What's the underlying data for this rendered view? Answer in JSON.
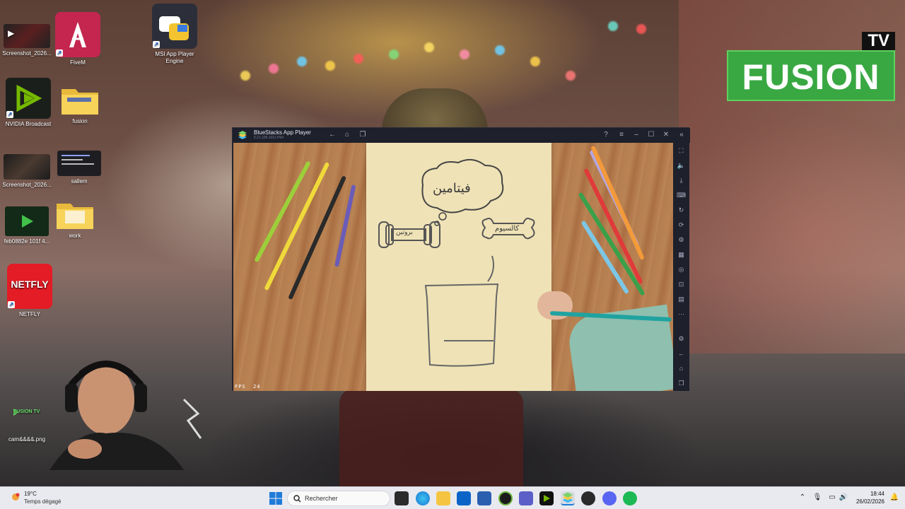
{
  "desktop": {
    "icons": [
      {
        "label": "Screenshot_2026..."
      },
      {
        "label": "FiveM"
      },
      {
        "label": "MSI App Player Engine"
      },
      {
        "label": "NVIDIA Broadcast"
      },
      {
        "label": "fusion"
      },
      {
        "label": "Screenshot_2026..."
      },
      {
        "label": "sallem"
      },
      {
        "label": "feb0882e 101f 4..."
      },
      {
        "label": "work"
      },
      {
        "label": "NETFLY",
        "thumb_text": "NETFLY"
      },
      {
        "label": "cam&&&&.png",
        "thumb_text": "FUSION TV"
      }
    ]
  },
  "overlay": {
    "logo_tv": "TV",
    "logo_word": "FUSION"
  },
  "bluestacks": {
    "title": "BlueStacks App Player",
    "version": "5.21.100.1011 P64",
    "fps_label": "FPS",
    "fps_value": "24",
    "video": {
      "thought_word": "فيتامين",
      "dumbbell_word": "بروتين",
      "bone_word": "كالسيوم"
    }
  },
  "taskbar": {
    "weather_temp": "19°C",
    "weather_condition": "Temps dégagé",
    "search_placeholder": "Rechercher",
    "time": "18:44",
    "date": "26/02/2026"
  },
  "colors": {
    "taskbar_bg": "#e9eaef",
    "bluestacks_chrome": "#1e202b",
    "fusion_green": "#39a842",
    "netfly_red": "#e31c25"
  }
}
